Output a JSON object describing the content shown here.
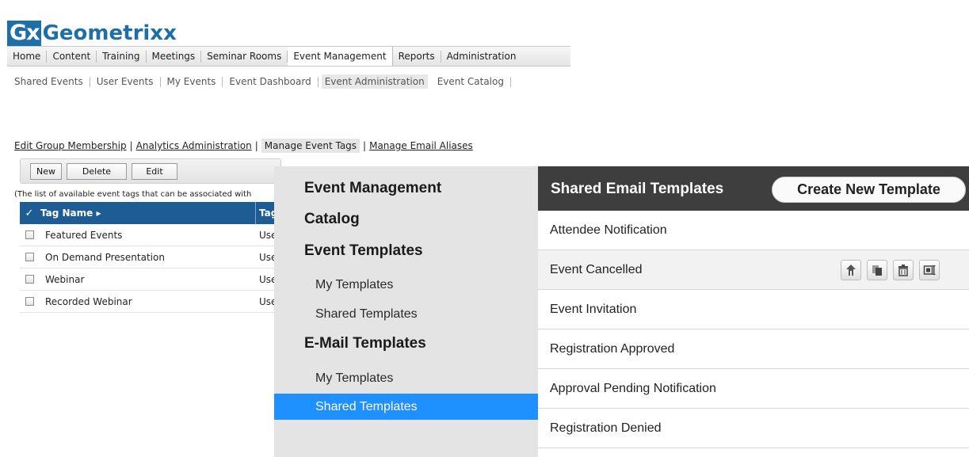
{
  "logo": {
    "mark": "Gx",
    "word": "Geometrixx"
  },
  "topnav": [
    "Home",
    "Content",
    "Training",
    "Meetings",
    "Seminar Rooms",
    "Event Management",
    "Reports",
    "Administration"
  ],
  "subnav": [
    "Shared Events",
    "User Events",
    "My Events",
    "Event Dashboard",
    "Event Administration",
    "Event Catalog"
  ],
  "admin_links": {
    "edit_group": "Edit Group Membership",
    "analytics": "Analytics Administration",
    "manage_tags": "Manage Event Tags",
    "email_aliases": "Manage Email Aliases",
    "sep": "|"
  },
  "tag_toolbar": {
    "new": "New",
    "delete": "Delete",
    "edit": "Edit"
  },
  "tag_description": "(The list of available event tags that can be associated with",
  "tag_table": {
    "header_check": "✓",
    "header_name": "Tag Name ▸",
    "header_desc": "Tag",
    "rows": [
      {
        "name": "Featured Events",
        "desc": "Use"
      },
      {
        "name": "On Demand Presentation",
        "desc": "Use"
      },
      {
        "name": "Webinar",
        "desc": "Use"
      },
      {
        "name": "Recorded Webinar",
        "desc": "Use"
      }
    ]
  },
  "menu": {
    "event_management": "Event Management",
    "catalog": "Catalog",
    "event_templates": "Event Templates",
    "event_my_templates": "My Templates",
    "event_shared_templates": "Shared Templates",
    "email_templates": "E-Mail Templates",
    "email_my_templates": "My Templates",
    "email_shared_templates": "Shared Templates"
  },
  "templates_panel": {
    "title": "Shared Email Templates",
    "create_button": "Create New Template",
    "items": [
      "Attendee Notification",
      "Event Cancelled",
      "Event Invitation",
      "Registration Approved",
      "Approval Pending Notification",
      "Registration Denied"
    ]
  },
  "colors": {
    "brand": "#1e6fa8",
    "table_header": "#1d5c94",
    "selected_menu": "#1e90ff",
    "panel_header": "#3e3e3e"
  }
}
